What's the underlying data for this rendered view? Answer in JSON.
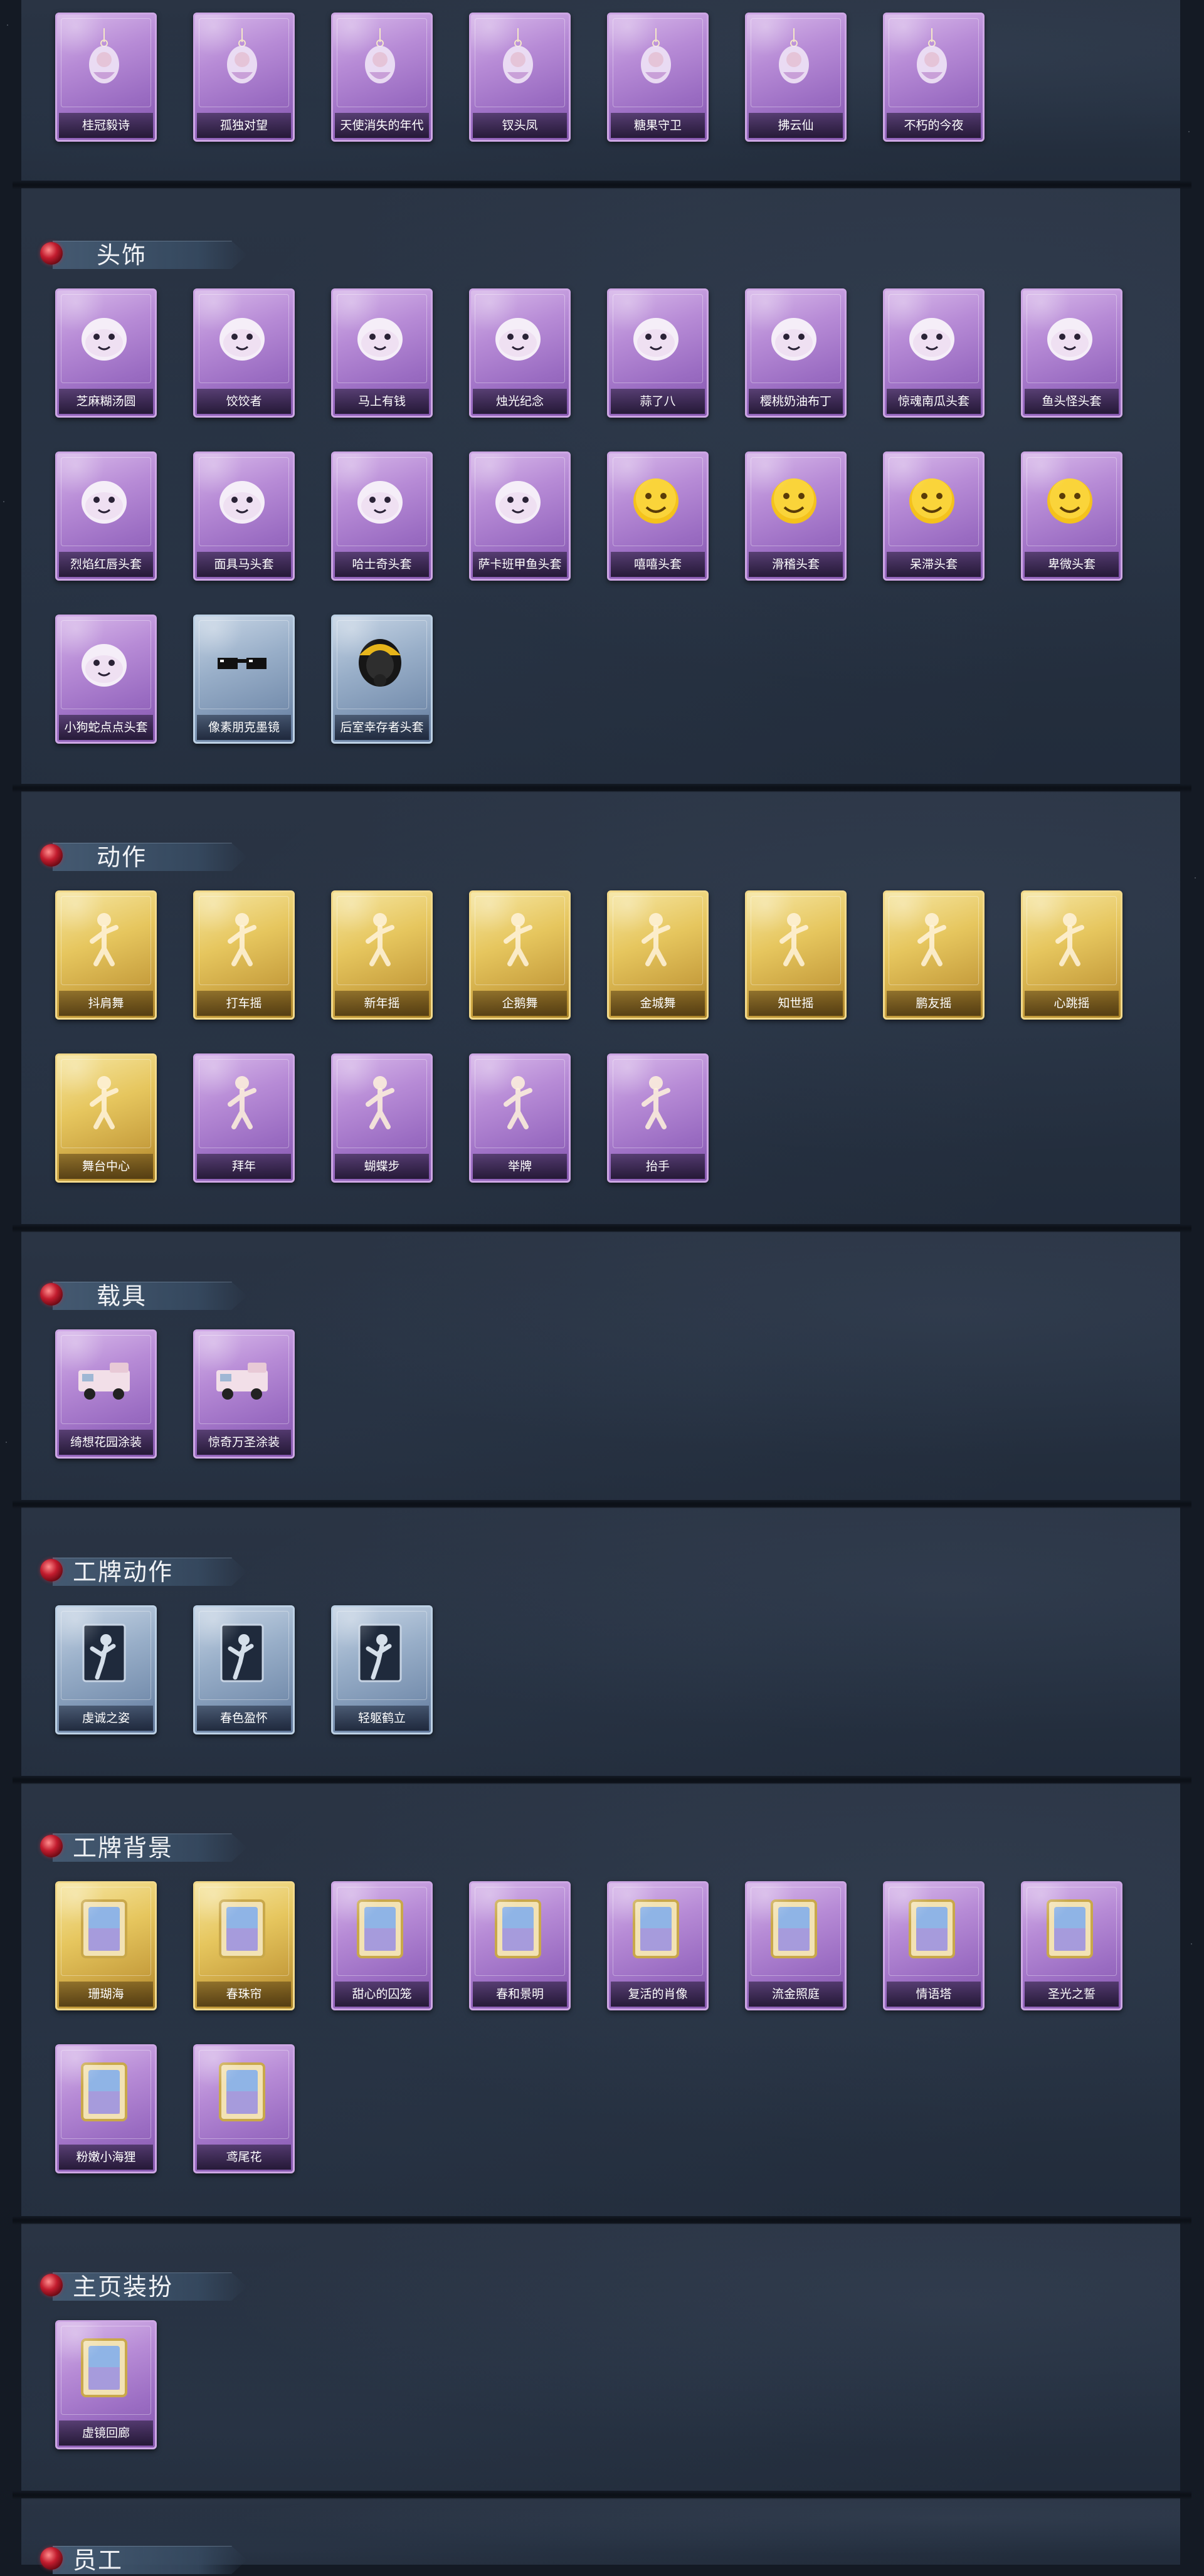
{
  "sections": [
    {
      "id": "pendants",
      "title": "",
      "items": [
        {
          "label": "桂冠毅诗",
          "kind": "pendant-icon"
        },
        {
          "label": "孤独对望",
          "kind": "pendant-icon"
        },
        {
          "label": "天使消失的年代",
          "kind": "pendant-icon"
        },
        {
          "label": "钗头凤",
          "kind": "pendant-icon"
        },
        {
          "label": "糖果守卫",
          "kind": "pendant-icon"
        },
        {
          "label": "拂云仙",
          "kind": "pendant-icon"
        },
        {
          "label": "不朽的今夜",
          "kind": "pendant-icon"
        }
      ]
    },
    {
      "id": "headwear",
      "title": "头饰",
      "items": [
        {
          "label": "芝麻糊汤圆",
          "kind": "face-icon"
        },
        {
          "label": "饺饺者",
          "kind": "face-icon"
        },
        {
          "label": "马上有钱",
          "kind": "face-icon"
        },
        {
          "label": "烛光纪念",
          "kind": "face-icon"
        },
        {
          "label": "蒜了八",
          "kind": "face-icon"
        },
        {
          "label": "樱桃奶油布丁",
          "kind": "face-icon"
        },
        {
          "label": "惊魂南瓜头套",
          "kind": "face-icon"
        },
        {
          "label": "鱼头怪头套",
          "kind": "face-icon"
        },
        {
          "label": "烈焰红唇头套",
          "kind": "face-icon"
        },
        {
          "label": "面具马头套",
          "kind": "face-icon"
        },
        {
          "label": "哈士奇头套",
          "kind": "face-icon"
        },
        {
          "label": "萨卡班甲鱼头套",
          "kind": "face-icon"
        },
        {
          "label": "嘻嘻头套",
          "kind": "emoji-icon"
        },
        {
          "label": "滑稽头套",
          "kind": "emoji-icon"
        },
        {
          "label": "呆滞头套",
          "kind": "emoji-icon"
        },
        {
          "label": "卑微头套",
          "kind": "emoji-icon"
        },
        {
          "label": "小狗蛇点点头套",
          "kind": "face-icon"
        },
        {
          "label": "像素朋克墨镜",
          "kind": "glasses-icon"
        },
        {
          "label": "后室幸存者头套",
          "kind": "helmet-icon"
        }
      ]
    },
    {
      "id": "actions",
      "title": "动作",
      "items": [
        {
          "label": "抖肩舞",
          "kind": "figure-icon"
        },
        {
          "label": "打车摇",
          "kind": "figure-icon"
        },
        {
          "label": "新年摇",
          "kind": "figure-icon"
        },
        {
          "label": "企鹅舞",
          "kind": "figure-icon"
        },
        {
          "label": "金城舞",
          "kind": "figure-icon"
        },
        {
          "label": "知世摇",
          "kind": "figure-icon"
        },
        {
          "label": "鹏友摇",
          "kind": "figure-icon"
        },
        {
          "label": "心跳摇",
          "kind": "figure-icon"
        },
        {
          "label": "舞台中心",
          "kind": "figure-icon"
        },
        {
          "label": "拜年",
          "kind": "figure-icon"
        },
        {
          "label": "蝴蝶步",
          "kind": "figure-icon"
        },
        {
          "label": "举牌",
          "kind": "figure-icon"
        },
        {
          "label": "抬手",
          "kind": "figure-icon"
        }
      ]
    },
    {
      "id": "vehicles",
      "title": "载具",
      "items": [
        {
          "label": "绮想花园涂装",
          "kind": "vehicle-icon"
        },
        {
          "label": "惊奇万圣涂装",
          "kind": "vehicle-icon"
        }
      ]
    },
    {
      "id": "badge-actions",
      "title": "工牌动作",
      "items": [
        {
          "label": "虔诚之姿",
          "kind": "silhouette-icon"
        },
        {
          "label": "春色盈怀",
          "kind": "silhouette-icon"
        },
        {
          "label": "轻躯鹤立",
          "kind": "silhouette-icon"
        }
      ]
    },
    {
      "id": "badge-backgrounds",
      "title": "工牌背景",
      "items": [
        {
          "label": "珊瑚海",
          "kind": "frame-icon"
        },
        {
          "label": "春珠帘",
          "kind": "frame-icon"
        },
        {
          "label": "甜心的囚笼",
          "kind": "frame-icon"
        },
        {
          "label": "春和景明",
          "kind": "frame-icon"
        },
        {
          "label": "复活的肖像",
          "kind": "frame-icon"
        },
        {
          "label": "流金照庭",
          "kind": "frame-icon"
        },
        {
          "label": "情语塔",
          "kind": "frame-icon"
        },
        {
          "label": "圣光之誓",
          "kind": "frame-icon"
        },
        {
          "label": "粉嫩小海狸",
          "kind": "frame-icon"
        },
        {
          "label": "鸢尾花",
          "kind": "frame-icon"
        }
      ]
    },
    {
      "id": "homepage-decor",
      "title": "主页装扮",
      "items": [
        {
          "label": "虚镜回廊",
          "kind": "frame-icon"
        }
      ]
    },
    {
      "id": "staff",
      "title": "员工",
      "items": []
    }
  ],
  "colors": {
    "card_purple": "#b78bd6",
    "card_gold": "#e6c65e",
    "card_blue": "#98aec8",
    "panel": "#273243",
    "header_bar": "#465c74",
    "gem": "#c21c2e"
  }
}
